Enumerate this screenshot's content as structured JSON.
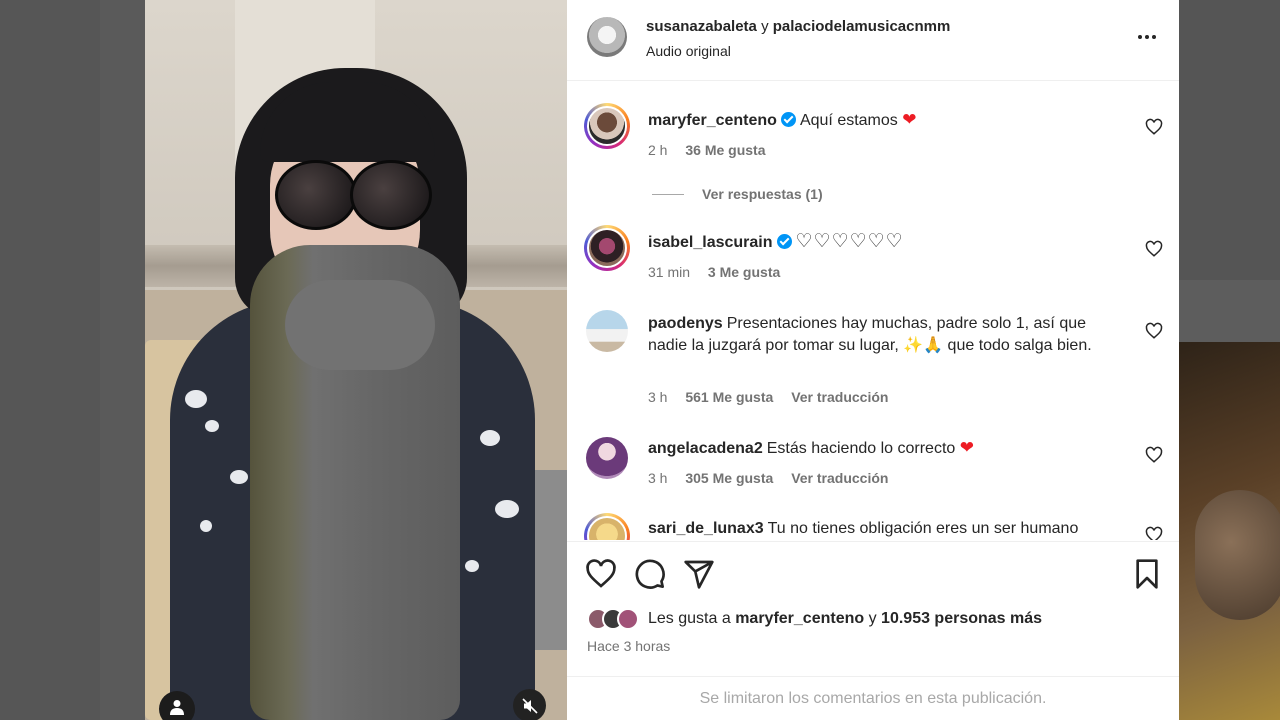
{
  "header": {
    "author1": "susanazabaleta",
    "joiner": "y",
    "author2": "palaciodelamusicacnmm",
    "audio": "Audio original"
  },
  "comments": [
    {
      "username": "maryfer_centeno",
      "verified": true,
      "text": "Aquí estamos",
      "emoji": "❤",
      "time": "2 h",
      "likes": "36 Me gusta",
      "replies": "Ver respuestas (1)"
    },
    {
      "username": "isabel_lascurain",
      "verified": true,
      "text": "♡♡♡♡♡♡",
      "time": "31 min",
      "likes": "3 Me gusta"
    },
    {
      "username": "paodenys",
      "verified": false,
      "text": "Presentaciones hay muchas, padre solo 1, así que nadie la juzgará por tomar su lugar, ✨🙏 que todo salga bien.",
      "time": "3 h",
      "likes": "561 Me gusta",
      "translate": "Ver traducción"
    },
    {
      "username": "angelacadena2",
      "verified": false,
      "text": "Estás haciendo lo correcto",
      "emoji": "❤",
      "time": "3 h",
      "likes": "305 Me gusta",
      "translate": "Ver traducción"
    },
    {
      "username": "sari_de_lunax3",
      "verified": false,
      "text": "Tu no tienes obligación eres un ser humano"
    }
  ],
  "actions": {
    "likes_prefix": "Les gusta a",
    "likes_user": "maryfer_centeno",
    "likes_join": "y",
    "likes_rest": "10.953 personas más",
    "time_ago": "Hace 3 horas"
  },
  "footer": {
    "notice": "Se limitaron los comentarios en esta publicación."
  },
  "colors": {
    "accent_blue": "#0095f6",
    "heart_red": "#ed1c24",
    "muted_text": "#737373"
  },
  "icons": [
    "more-icon",
    "heart-icon",
    "comment-icon",
    "share-icon",
    "bookmark-icon",
    "user-icon",
    "mute-icon",
    "verified-icon"
  ]
}
